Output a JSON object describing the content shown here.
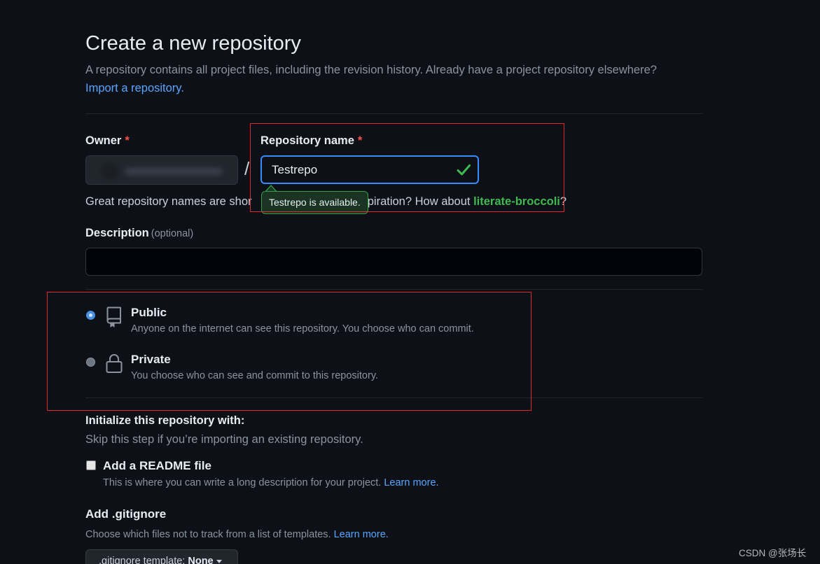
{
  "header": {
    "title": "Create a new repository",
    "subtitle": "A repository contains all project files, including the revision history. Already have a project repository elsewhere?",
    "import_link": "Import a repository."
  },
  "owner": {
    "label": "Owner",
    "required_mark": "*"
  },
  "separator": "/",
  "repo_name": {
    "label": "Repository name",
    "required_mark": "*",
    "value": "Testrepo",
    "tooltip": "Testrepo is available.",
    "hint_prefix": "Great repository names are shor",
    "hint_mid": "eed inspiration? How about ",
    "hint_suggestion": "literate-broccoli",
    "hint_suffix": "?",
    "status_color": "#3fb950"
  },
  "description": {
    "label": "Description",
    "optional": "(optional)",
    "value": ""
  },
  "visibility": {
    "public": {
      "title": "Public",
      "description": "Anyone on the internet can see this repository. You choose who can commit.",
      "checked": true
    },
    "private": {
      "title": "Private",
      "description": "You choose who can see and commit to this repository.",
      "checked": false
    }
  },
  "initialize": {
    "title": "Initialize this repository with:",
    "subtitle": "Skip this step if you’re importing an existing repository.",
    "readme": {
      "label": "Add a README file",
      "description": "This is where you can write a long description for your project.",
      "learn_more": "Learn more.",
      "checked": false
    }
  },
  "gitignore": {
    "title": "Add .gitignore",
    "description": "Choose which files not to track from a list of templates.",
    "learn_more": "Learn more.",
    "button_prefix": ".gitignore template:",
    "button_value": "None"
  },
  "watermark": "CSDN @张场长",
  "colors": {
    "background": "#0d1117",
    "accent": "#58a6ff",
    "success": "#3fb950",
    "annotation": "#e02a2a"
  }
}
